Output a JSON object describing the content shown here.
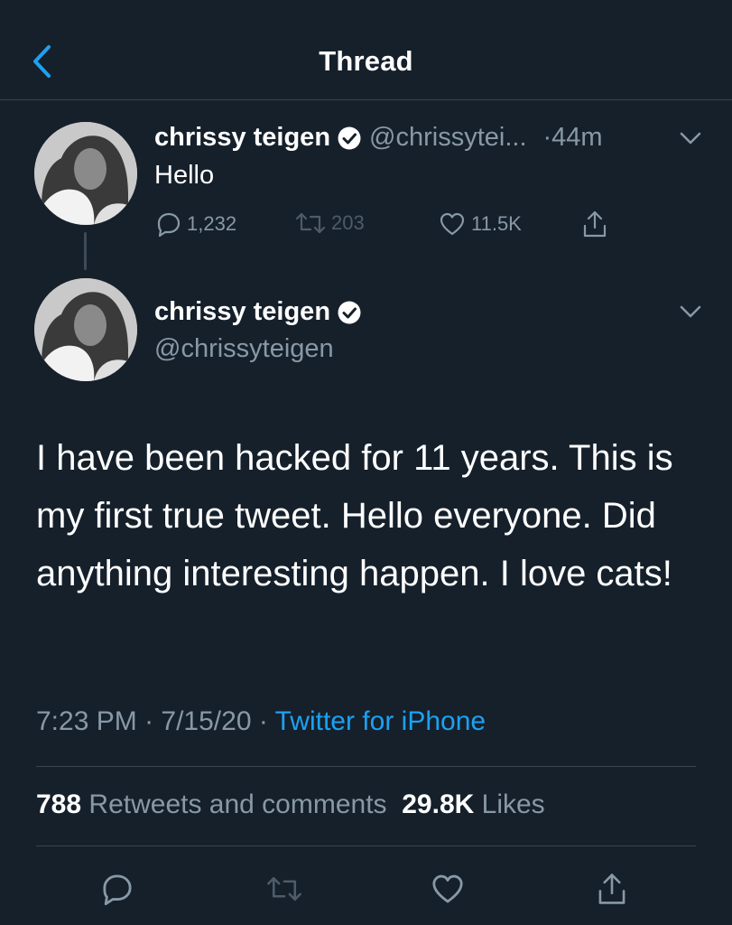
{
  "header": {
    "title": "Thread",
    "back_icon": "chevron-left-icon"
  },
  "colors": {
    "background": "#15202b",
    "accent": "#1da1f2",
    "secondary_text": "#8899a6",
    "divider": "#38444d"
  },
  "parent_tweet": {
    "display_name": "chrissy teigen",
    "handle": "@chrissytei...",
    "time": "·44m",
    "text": "Hello",
    "replies": "1,232",
    "retweets": "203",
    "likes": "11.5K"
  },
  "main_tweet": {
    "display_name": "chrissy teigen",
    "handle": "@chrissyteigen",
    "text": "I have been hacked for 11 years. This is my first true tweet. Hello everyone. Did anything interesting happen. I love cats!",
    "time": "7:23 PM",
    "date": "7/15/20",
    "source": "Twitter for iPhone",
    "separator": "·",
    "retweets_count": "788",
    "retweets_label": "Retweets and comments",
    "likes_count": "29.8K",
    "likes_label": "Likes"
  }
}
